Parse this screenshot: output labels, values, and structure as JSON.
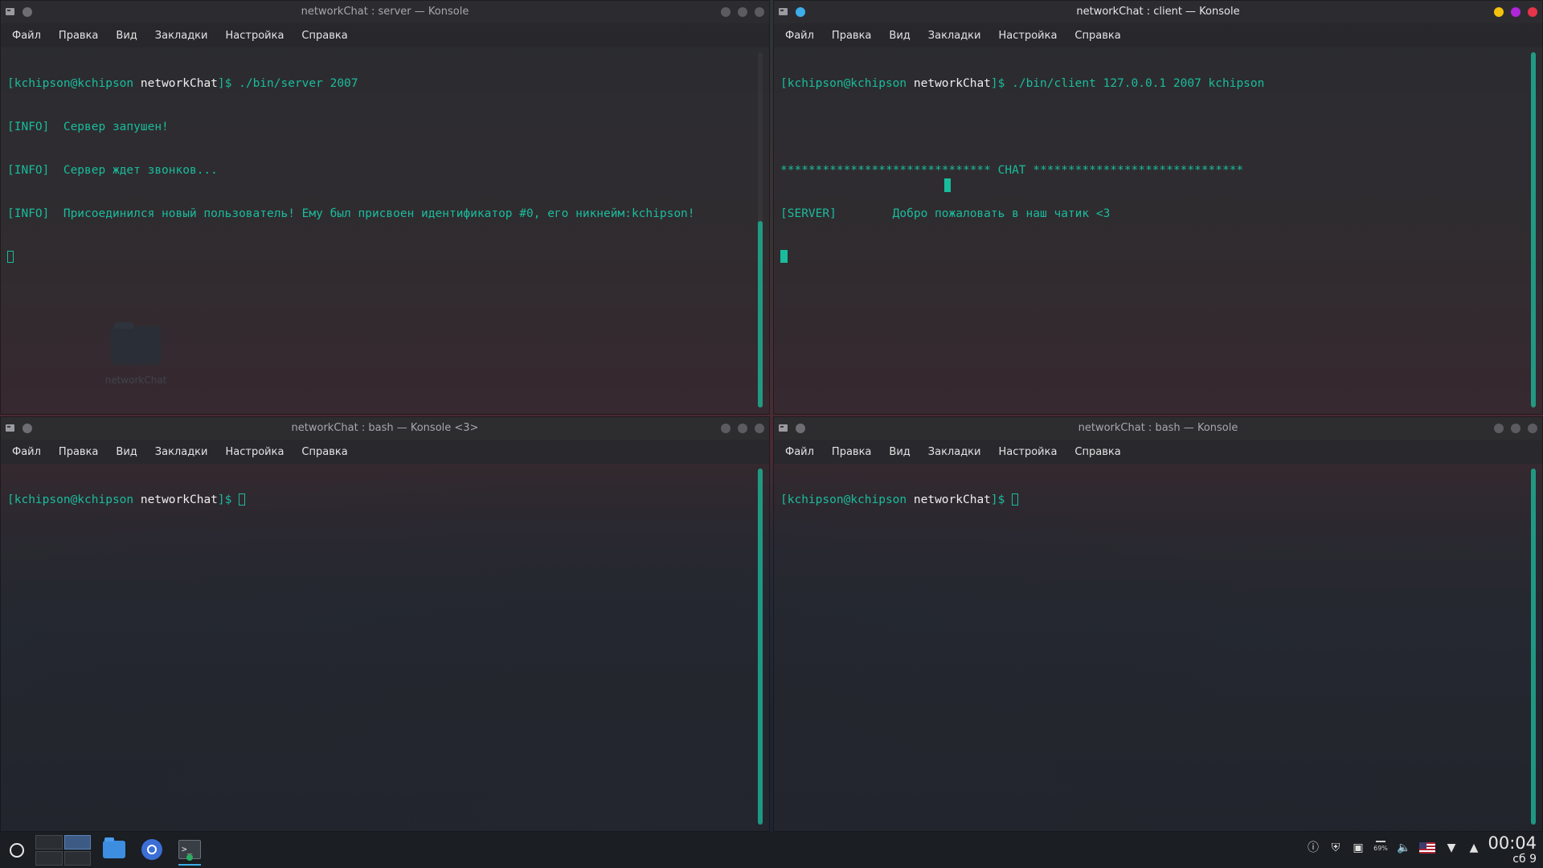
{
  "windows": {
    "server": {
      "title": "networkChat : server — Konsole",
      "menu": [
        "Файл",
        "Правка",
        "Вид",
        "Закладки",
        "Настройка",
        "Справка"
      ],
      "prompt": {
        "user": "[kchipson@kchipson",
        "dir": "networkChat",
        "suffix": "]$",
        "command": " ./bin/server 2007"
      },
      "lines": [
        "[INFO]  Сервер запушен!",
        "[INFO]  Сервер ждет звонков...",
        "[INFO]  Присоединился новый пользователь! Ему был присвоен идентификатор #0, его никнейм:kchipson!"
      ]
    },
    "client": {
      "title": "networkChat : client — Konsole",
      "menu": [
        "Файл",
        "Правка",
        "Вид",
        "Закладки",
        "Настройка",
        "Справка"
      ],
      "prompt": {
        "user": "[kchipson@kchipson",
        "dir": "networkChat",
        "suffix": "]$",
        "command": " ./bin/client 127.0.0.1 2007 kchipson"
      },
      "banner": "****************************** CHAT ******************************",
      "server_line": "[SERVER]        Добро пожаловать в наш чатик <3"
    },
    "bash1": {
      "title": "networkChat : bash — Konsole <3>",
      "menu": [
        "Файл",
        "Правка",
        "Вид",
        "Закладки",
        "Настройка",
        "Справка"
      ],
      "prompt": {
        "user": "[kchipson@kchipson",
        "dir": "networkChat",
        "suffix": "]$"
      }
    },
    "bash2": {
      "title": "networkChat : bash — Konsole",
      "menu": [
        "Файл",
        "Правка",
        "Вид",
        "Закладки",
        "Настройка",
        "Справка"
      ],
      "prompt": {
        "user": "[kchipson@kchipson",
        "dir": "networkChat",
        "suffix": "]$"
      }
    }
  },
  "desktop": {
    "folder_label": "networkChat"
  },
  "taskbar": {
    "tray": {
      "battery_percent": "69%"
    },
    "clock": {
      "time": "00:04",
      "date": "сб 9"
    }
  },
  "colors": {
    "terminal_text": "#1abc9c",
    "prompt_dir": "#f0f0f0",
    "accent_blue": "#3daee9",
    "close_red": "#e8344b",
    "min_yellow": "#f4c20d",
    "max_purple": "#b026d9"
  },
  "icons": {
    "launcher": "launcher-icon",
    "files": "folder-icon",
    "browser": "chromium-icon",
    "terminal": "konsole-icon",
    "notifications": "alert-icon",
    "vault": "shield-icon",
    "clipboard": "clipboard-icon",
    "battery": "battery-icon",
    "volume": "speaker-icon",
    "keyboard_layout": "us-flag-icon",
    "network": "wifi-icon",
    "expand": "chevron-up-icon"
  }
}
